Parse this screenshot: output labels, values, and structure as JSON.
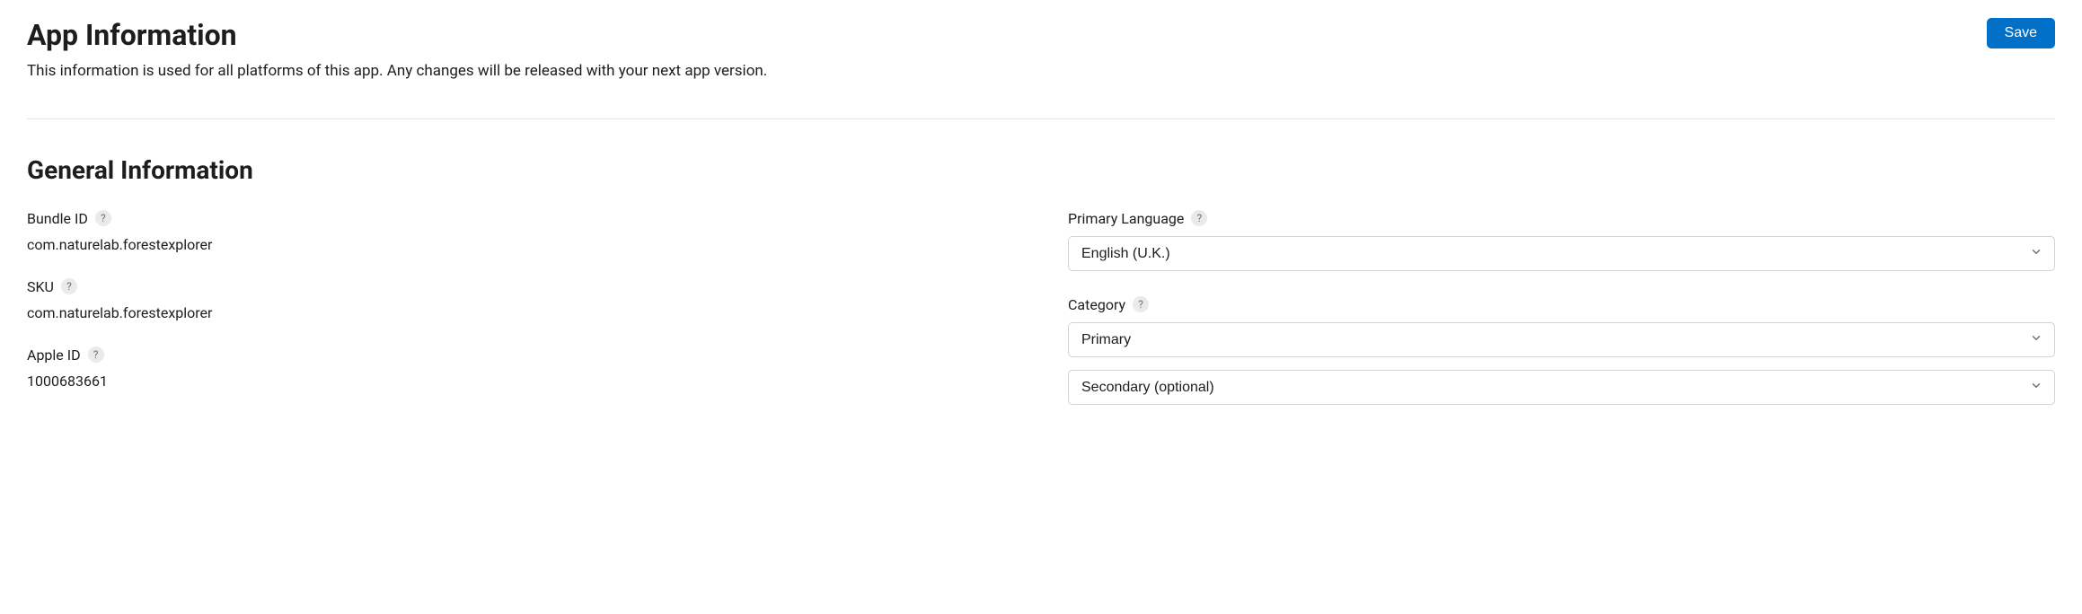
{
  "header": {
    "title": "App Information",
    "subtitle": "This information is used for all platforms of this app. Any changes will be released with your next app version.",
    "save_label": "Save"
  },
  "section": {
    "title": "General Information"
  },
  "left": {
    "bundle_id_label": "Bundle ID",
    "bundle_id_value": "com.naturelab.forestexplorer",
    "sku_label": "SKU",
    "sku_value": "com.naturelab.forestexplorer",
    "apple_id_label": "Apple ID",
    "apple_id_value": "1000683661"
  },
  "right": {
    "primary_language_label": "Primary Language",
    "primary_language_value": "English (U.K.)",
    "category_label": "Category",
    "category_primary_value": "Primary",
    "category_secondary_value": "Secondary (optional)"
  },
  "help_glyph": "?"
}
